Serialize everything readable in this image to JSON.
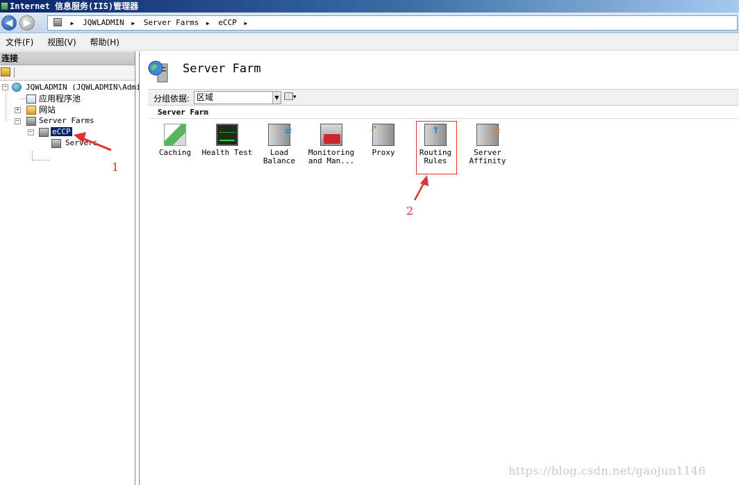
{
  "window": {
    "title": "Internet 信息服务(IIS)管理器"
  },
  "address": {
    "crumbs": [
      "JQWLADMIN",
      "Server Farms",
      "eCCP"
    ]
  },
  "menu": [
    "文件(F)",
    "视图(V)",
    "帮助(H)"
  ],
  "connections": {
    "header": "连接",
    "tree": {
      "root": "JQWLADMIN (JQWLADMIN\\Admin",
      "app_pools": "应用程序池",
      "sites": "网站",
      "server_farms": "Server Farms",
      "farm": "eCCP",
      "servers": "Servers"
    }
  },
  "main": {
    "title": "Server Farm",
    "group_by_label": "分组依据:",
    "group_by_value": "区域",
    "section_title": "Server Farm",
    "features": [
      {
        "label": "Caching",
        "icon": "caching-icon"
      },
      {
        "label": "Health Test",
        "icon": "health-test-icon"
      },
      {
        "label": "Load\nBalance",
        "icon": "load-balance-icon"
      },
      {
        "label": "Monitoring\nand Man...",
        "icon": "monitoring-icon"
      },
      {
        "label": "Proxy",
        "icon": "proxy-icon"
      },
      {
        "label": "Routing\nRules",
        "icon": "routing-rules-icon"
      },
      {
        "label": "Server\nAffinity",
        "icon": "server-affinity-icon"
      }
    ]
  },
  "annotations": {
    "one": "1",
    "two": "2",
    "color": "#e0312c"
  },
  "watermark": "https://blog.csdn.net/gaojun1146"
}
